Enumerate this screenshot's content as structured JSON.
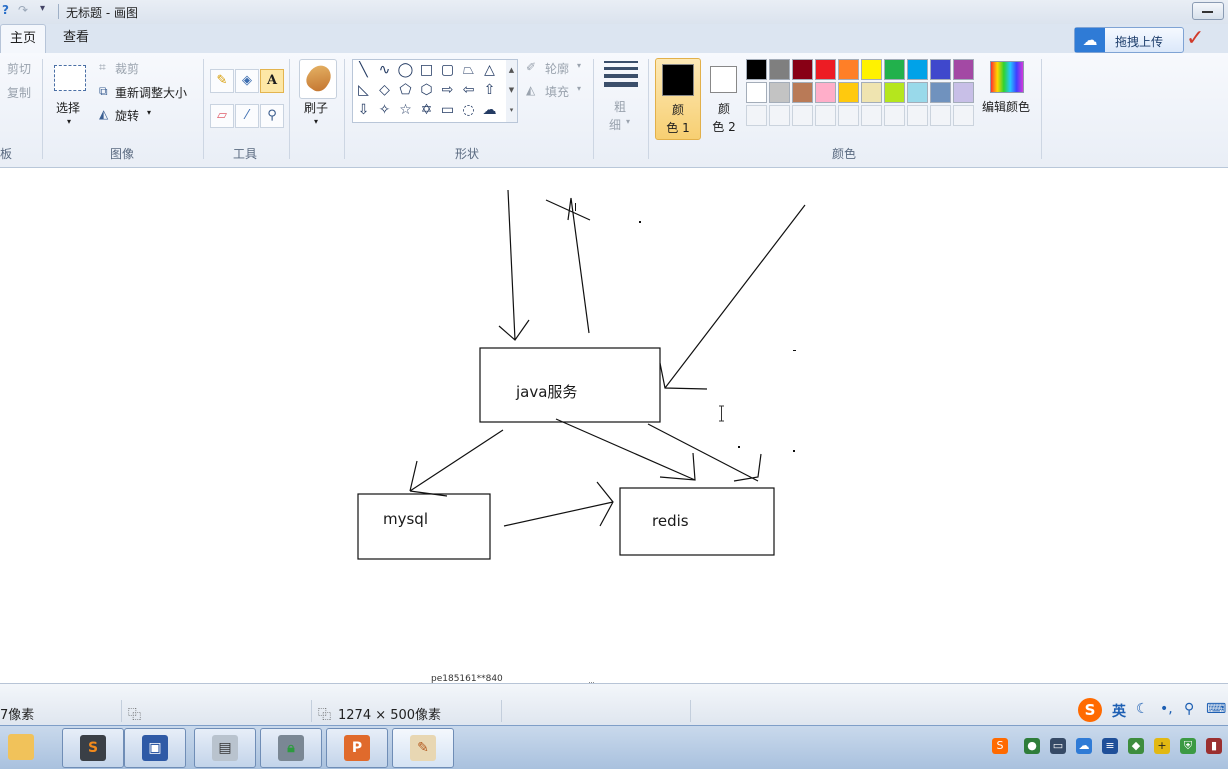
{
  "window": {
    "title": "无标题 - 画图"
  },
  "tabs": {
    "home": "主页",
    "view": "查看"
  },
  "top_right": {
    "upload_label": "拖拽上传"
  },
  "ribbon": {
    "clipboard": {
      "cut": "剪切",
      "copy": "复制",
      "group": "板"
    },
    "image": {
      "select": "选择",
      "crop": "裁剪",
      "resize": "重新调整大小",
      "rotate": "旋转",
      "group": "图像"
    },
    "tools": {
      "group": "工具",
      "text_tool": "A"
    },
    "brushes": {
      "label": "刷子"
    },
    "shapes": {
      "outline": "轮廓",
      "fill": "填充",
      "group": "形状"
    },
    "size": {
      "label_line1": "粗",
      "label_line2": "细"
    },
    "colors": {
      "color1_line1": "颜",
      "color1_line2": "色 1",
      "color2_line1": "颜",
      "color2_line2": "色 2",
      "edit_colors": "编辑颜色",
      "group": "颜色",
      "color1_value": "#000000",
      "color2_value": "#ffffff",
      "palette_row1": [
        "#000000",
        "#7f7f7f",
        "#880015",
        "#ed1c24",
        "#ff7f27",
        "#fff200",
        "#22b14c",
        "#00a2e8",
        "#3f48cc",
        "#a349a4"
      ],
      "palette_row2": [
        "#ffffff",
        "#c3c3c3",
        "#b97a57",
        "#ffaec9",
        "#ffc90e",
        "#efe4b0",
        "#b5e61d",
        "#99d9ea",
        "#7092be",
        "#c8bfe7"
      ]
    }
  },
  "canvas": {
    "labels": {
      "java": "java服务",
      "mysql": "mysql",
      "redis": "redis"
    },
    "watermark": "pe185161**840"
  },
  "status": {
    "position": "7像素",
    "image_size": "1274 × 500像素"
  },
  "ime": {
    "mode": "英",
    "logo": "S"
  }
}
